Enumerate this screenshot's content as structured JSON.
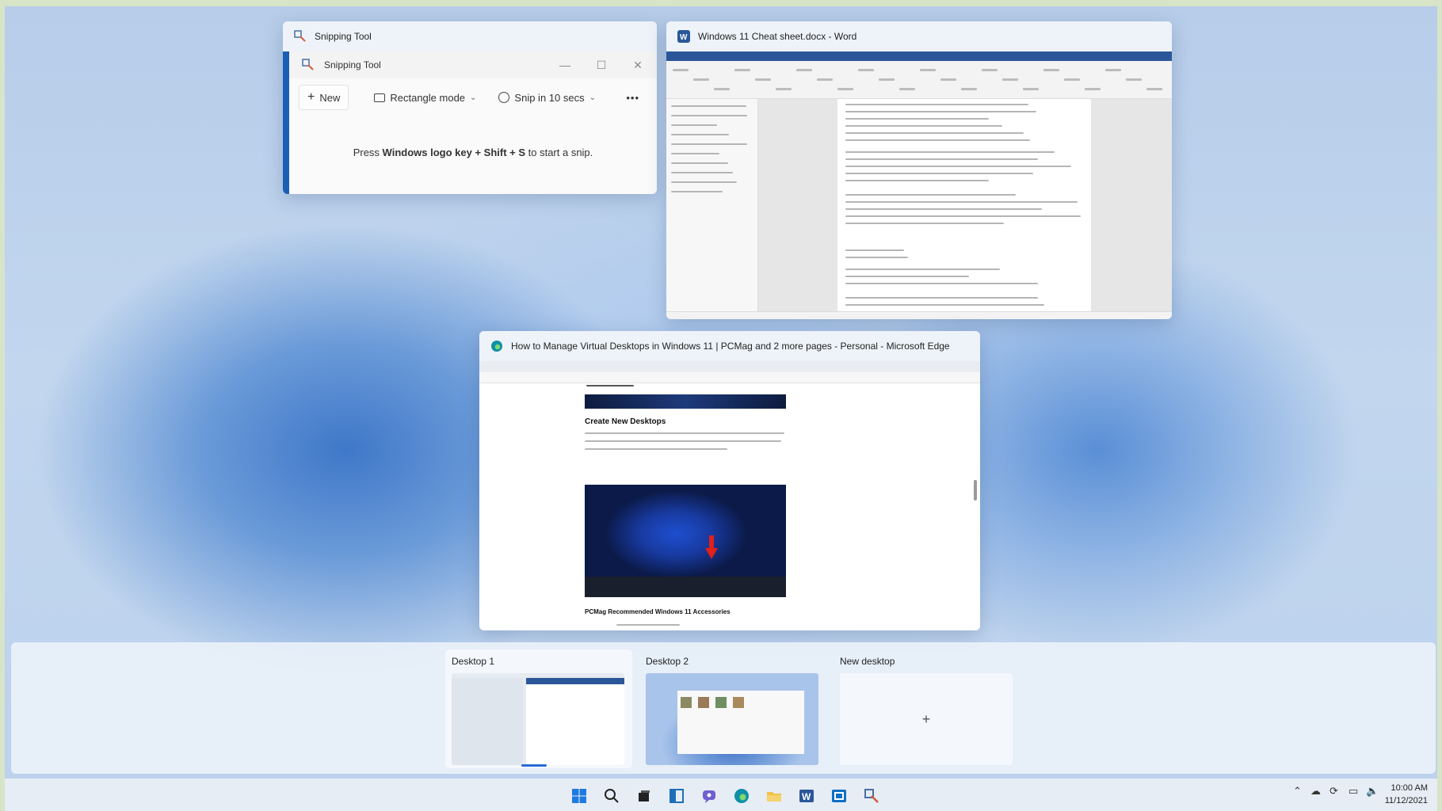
{
  "windows": {
    "snipping": {
      "title": "Snipping Tool",
      "app_title": "Snipping Tool",
      "new_label": "New",
      "mode_label": "Rectangle mode",
      "delay_label": "Snip in 10 secs",
      "hint_prefix": "Press ",
      "hint_keys": "Windows logo key + Shift + S",
      "hint_suffix": " to start a snip."
    },
    "word": {
      "title": "Windows 11 Cheat sheet.docx - Word"
    },
    "edge": {
      "title": "How to Manage Virtual Desktops in Windows 11 | PCMag and 2 more pages - Personal - Microsoft Edge",
      "article_heading": "Create New Desktops",
      "section_heading": "PCMag Recommended Windows 11 Accessories"
    }
  },
  "desktops": {
    "items": [
      {
        "label": "Desktop 1"
      },
      {
        "label": "Desktop 2"
      },
      {
        "label": "New desktop",
        "plus": "+"
      }
    ]
  },
  "taskbar": {
    "time": "10:00 AM",
    "date": "11/12/2021",
    "icons": [
      "start-icon",
      "search-icon",
      "task-view-icon",
      "widgets-icon",
      "chat-icon",
      "edge-icon",
      "file-explorer-icon",
      "word-icon",
      "outlook-icon",
      "snipping-tool-icon"
    ]
  },
  "colors": {
    "accent": "#1a5fb4",
    "word_blue": "#2b579a",
    "edge_teal": "#0f8fa8",
    "arrow_red": "#e0201a"
  }
}
